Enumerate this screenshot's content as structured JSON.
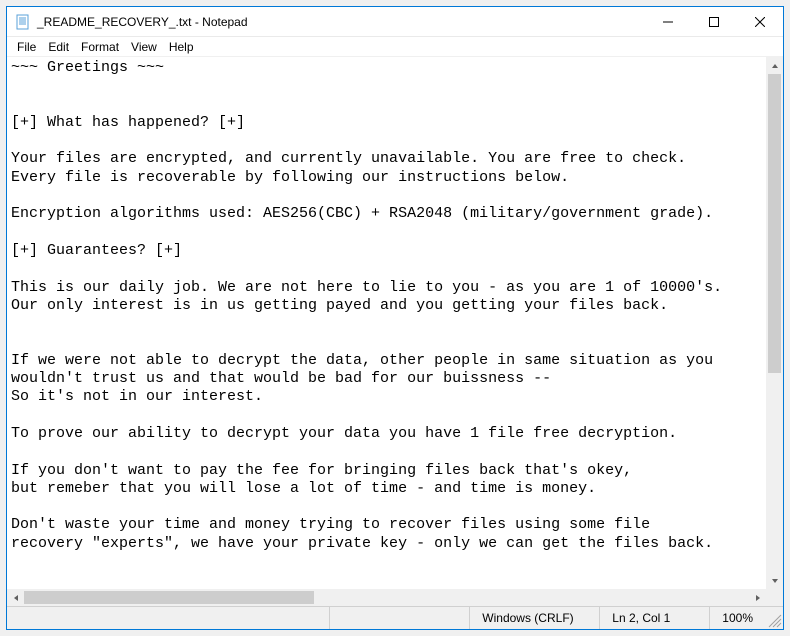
{
  "window": {
    "title": "_README_RECOVERY_.txt - Notepad"
  },
  "menu": {
    "file": "File",
    "edit": "Edit",
    "format": "Format",
    "view": "View",
    "help": "Help"
  },
  "content": "~~~ Greetings ~~~\n\n\n[+] What has happened? [+]\n\nYour files are encrypted, and currently unavailable. You are free to check.\nEvery file is recoverable by following our instructions below.\n\nEncryption algorithms used: AES256(CBC) + RSA2048 (military/government grade).\n\n[+] Guarantees? [+]\n\nThis is our daily job. We are not here to lie to you - as you are 1 of 10000's.\nOur only interest is in us getting payed and you getting your files back.\n\n\nIf we were not able to decrypt the data, other people in same situation as you\nwouldn't trust us and that would be bad for our buissness --\nSo it's not in our interest.\n\nTo prove our ability to decrypt your data you have 1 file free decryption.\n\nIf you don't want to pay the fee for bringing files back that's okey,\nbut remeber that you will lose a lot of time - and time is money.\n\nDon't waste your time and money trying to recover files using some file\nrecovery \"experts\", we have your private key - only we can get the files back.",
  "status": {
    "encoding": "Windows (CRLF)",
    "position": "Ln 2, Col 1",
    "zoom": "100%"
  }
}
